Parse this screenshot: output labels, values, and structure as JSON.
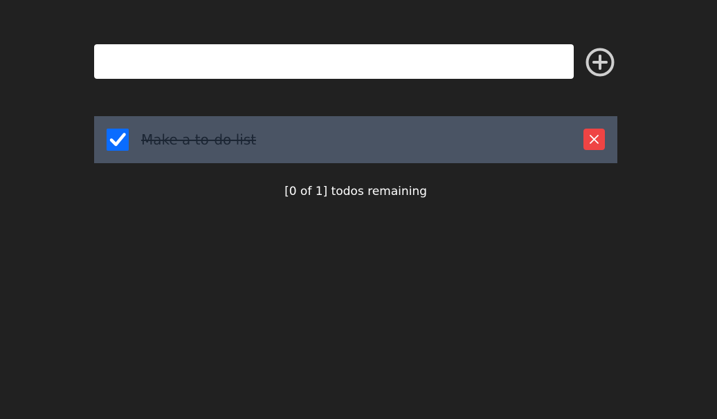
{
  "new_todo": {
    "value": "",
    "placeholder": "",
    "add_icon": "plus-circle-icon"
  },
  "todos": [
    {
      "text": "Make a to-do list",
      "completed": true,
      "checkbox_icon": "check-icon",
      "delete_icon": "close-icon"
    }
  ],
  "footer": {
    "remaining_text": "[0 of 1] todos remaining"
  },
  "colors": {
    "background": "#212121",
    "todo_row": "#4a5464",
    "checkbox": "#0a6cff",
    "delete": "#ef4444",
    "add_icon": "#cfcfcf"
  }
}
